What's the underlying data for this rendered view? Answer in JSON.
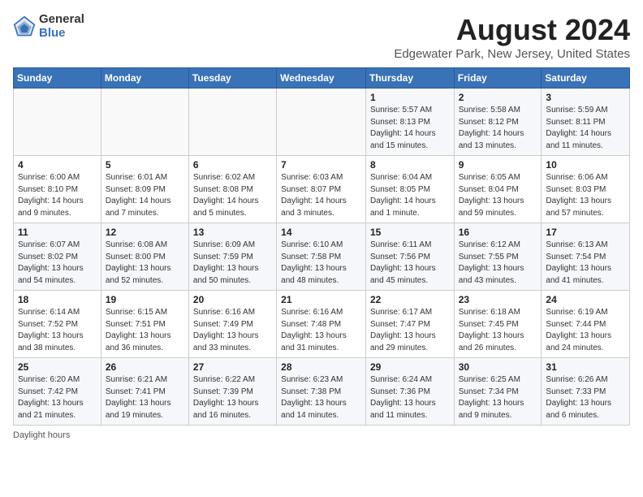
{
  "header": {
    "logo_general": "General",
    "logo_blue": "Blue",
    "title": "August 2024",
    "subtitle": "Edgewater Park, New Jersey, United States"
  },
  "days_of_week": [
    "Sunday",
    "Monday",
    "Tuesday",
    "Wednesday",
    "Thursday",
    "Friday",
    "Saturday"
  ],
  "weeks": [
    [
      {
        "day": "",
        "info": ""
      },
      {
        "day": "",
        "info": ""
      },
      {
        "day": "",
        "info": ""
      },
      {
        "day": "",
        "info": ""
      },
      {
        "day": "1",
        "info": "Sunrise: 5:57 AM\nSunset: 8:13 PM\nDaylight: 14 hours and 15 minutes."
      },
      {
        "day": "2",
        "info": "Sunrise: 5:58 AM\nSunset: 8:12 PM\nDaylight: 14 hours and 13 minutes."
      },
      {
        "day": "3",
        "info": "Sunrise: 5:59 AM\nSunset: 8:11 PM\nDaylight: 14 hours and 11 minutes."
      }
    ],
    [
      {
        "day": "4",
        "info": "Sunrise: 6:00 AM\nSunset: 8:10 PM\nDaylight: 14 hours and 9 minutes."
      },
      {
        "day": "5",
        "info": "Sunrise: 6:01 AM\nSunset: 8:09 PM\nDaylight: 14 hours and 7 minutes."
      },
      {
        "day": "6",
        "info": "Sunrise: 6:02 AM\nSunset: 8:08 PM\nDaylight: 14 hours and 5 minutes."
      },
      {
        "day": "7",
        "info": "Sunrise: 6:03 AM\nSunset: 8:07 PM\nDaylight: 14 hours and 3 minutes."
      },
      {
        "day": "8",
        "info": "Sunrise: 6:04 AM\nSunset: 8:05 PM\nDaylight: 14 hours and 1 minute."
      },
      {
        "day": "9",
        "info": "Sunrise: 6:05 AM\nSunset: 8:04 PM\nDaylight: 13 hours and 59 minutes."
      },
      {
        "day": "10",
        "info": "Sunrise: 6:06 AM\nSunset: 8:03 PM\nDaylight: 13 hours and 57 minutes."
      }
    ],
    [
      {
        "day": "11",
        "info": "Sunrise: 6:07 AM\nSunset: 8:02 PM\nDaylight: 13 hours and 54 minutes."
      },
      {
        "day": "12",
        "info": "Sunrise: 6:08 AM\nSunset: 8:00 PM\nDaylight: 13 hours and 52 minutes."
      },
      {
        "day": "13",
        "info": "Sunrise: 6:09 AM\nSunset: 7:59 PM\nDaylight: 13 hours and 50 minutes."
      },
      {
        "day": "14",
        "info": "Sunrise: 6:10 AM\nSunset: 7:58 PM\nDaylight: 13 hours and 48 minutes."
      },
      {
        "day": "15",
        "info": "Sunrise: 6:11 AM\nSunset: 7:56 PM\nDaylight: 13 hours and 45 minutes."
      },
      {
        "day": "16",
        "info": "Sunrise: 6:12 AM\nSunset: 7:55 PM\nDaylight: 13 hours and 43 minutes."
      },
      {
        "day": "17",
        "info": "Sunrise: 6:13 AM\nSunset: 7:54 PM\nDaylight: 13 hours and 41 minutes."
      }
    ],
    [
      {
        "day": "18",
        "info": "Sunrise: 6:14 AM\nSunset: 7:52 PM\nDaylight: 13 hours and 38 minutes."
      },
      {
        "day": "19",
        "info": "Sunrise: 6:15 AM\nSunset: 7:51 PM\nDaylight: 13 hours and 36 minutes."
      },
      {
        "day": "20",
        "info": "Sunrise: 6:16 AM\nSunset: 7:49 PM\nDaylight: 13 hours and 33 minutes."
      },
      {
        "day": "21",
        "info": "Sunrise: 6:16 AM\nSunset: 7:48 PM\nDaylight: 13 hours and 31 minutes."
      },
      {
        "day": "22",
        "info": "Sunrise: 6:17 AM\nSunset: 7:47 PM\nDaylight: 13 hours and 29 minutes."
      },
      {
        "day": "23",
        "info": "Sunrise: 6:18 AM\nSunset: 7:45 PM\nDaylight: 13 hours and 26 minutes."
      },
      {
        "day": "24",
        "info": "Sunrise: 6:19 AM\nSunset: 7:44 PM\nDaylight: 13 hours and 24 minutes."
      }
    ],
    [
      {
        "day": "25",
        "info": "Sunrise: 6:20 AM\nSunset: 7:42 PM\nDaylight: 13 hours and 21 minutes."
      },
      {
        "day": "26",
        "info": "Sunrise: 6:21 AM\nSunset: 7:41 PM\nDaylight: 13 hours and 19 minutes."
      },
      {
        "day": "27",
        "info": "Sunrise: 6:22 AM\nSunset: 7:39 PM\nDaylight: 13 hours and 16 minutes."
      },
      {
        "day": "28",
        "info": "Sunrise: 6:23 AM\nSunset: 7:38 PM\nDaylight: 13 hours and 14 minutes."
      },
      {
        "day": "29",
        "info": "Sunrise: 6:24 AM\nSunset: 7:36 PM\nDaylight: 13 hours and 11 minutes."
      },
      {
        "day": "30",
        "info": "Sunrise: 6:25 AM\nSunset: 7:34 PM\nDaylight: 13 hours and 9 minutes."
      },
      {
        "day": "31",
        "info": "Sunrise: 6:26 AM\nSunset: 7:33 PM\nDaylight: 13 hours and 6 minutes."
      }
    ]
  ],
  "footer": "Daylight hours"
}
